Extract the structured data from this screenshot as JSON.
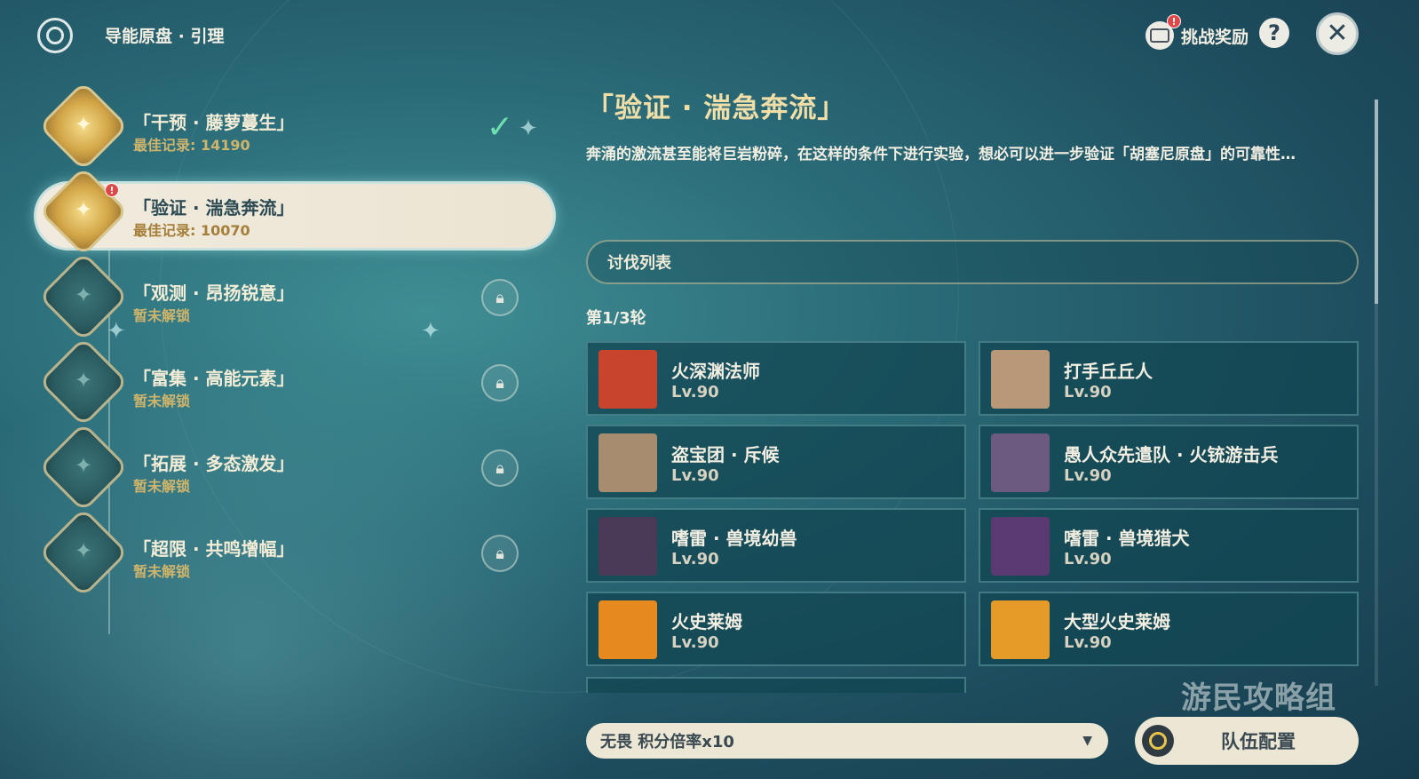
{
  "header": {
    "title": "导能原盘 · 引理",
    "reward_label": "挑战奖励",
    "reward_badge": "!",
    "help_label": "?",
    "close_label": "✕"
  },
  "stages": [
    {
      "name": "「干预 · 藤萝蔓生」",
      "sub": "最佳记录: 14190",
      "status": "completed"
    },
    {
      "name": "「验证 · 湍急奔流」",
      "sub": "最佳记录: 10070",
      "status": "selected",
      "badge": "!"
    },
    {
      "name": "「观测 · 昂扬锐意」",
      "sub": "暂未解锁",
      "status": "locked"
    },
    {
      "name": "「富集 · 高能元素」",
      "sub": "暂未解锁",
      "status": "locked"
    },
    {
      "name": "「拓展 · 多态激发」",
      "sub": "暂未解锁",
      "status": "locked"
    },
    {
      "name": "「超限 · 共鸣增幅」",
      "sub": "暂未解锁",
      "status": "locked"
    }
  ],
  "detail": {
    "title": "「验证 · 湍急奔流」",
    "description": "奔涌的激流甚至能将巨岩粉碎，在这样的条件下进行实验，想必可以进一步验证「胡塞尼原盘」的可靠性…",
    "tab_label": "讨伐列表",
    "round_label": "第1/3轮",
    "enemies": [
      {
        "name": "火深渊法师",
        "level": "Lv.90",
        "color": "#c8442c"
      },
      {
        "name": "打手丘丘人",
        "level": "Lv.90",
        "color": "#b89878"
      },
      {
        "name": "盗宝团 · 斥候",
        "level": "Lv.90",
        "color": "#a88c70"
      },
      {
        "name": "愚人众先遣队 · 火铳游击兵",
        "level": "Lv.90",
        "color": "#6c5a80"
      },
      {
        "name": "嗜雷 · 兽境幼兽",
        "level": "Lv.90",
        "color": "#4a3a58"
      },
      {
        "name": "嗜雷 · 兽境猎犬",
        "level": "Lv.90",
        "color": "#5a3a70"
      },
      {
        "name": "火史莱姆",
        "level": "Lv.90",
        "color": "#e68a20"
      },
      {
        "name": "大型火史莱姆",
        "level": "Lv.90",
        "color": "#e69a28"
      }
    ]
  },
  "footer": {
    "difficulty_label": "无畏 积分倍率x10",
    "team_label": "队伍配置"
  },
  "watermark": "游民攻略组"
}
